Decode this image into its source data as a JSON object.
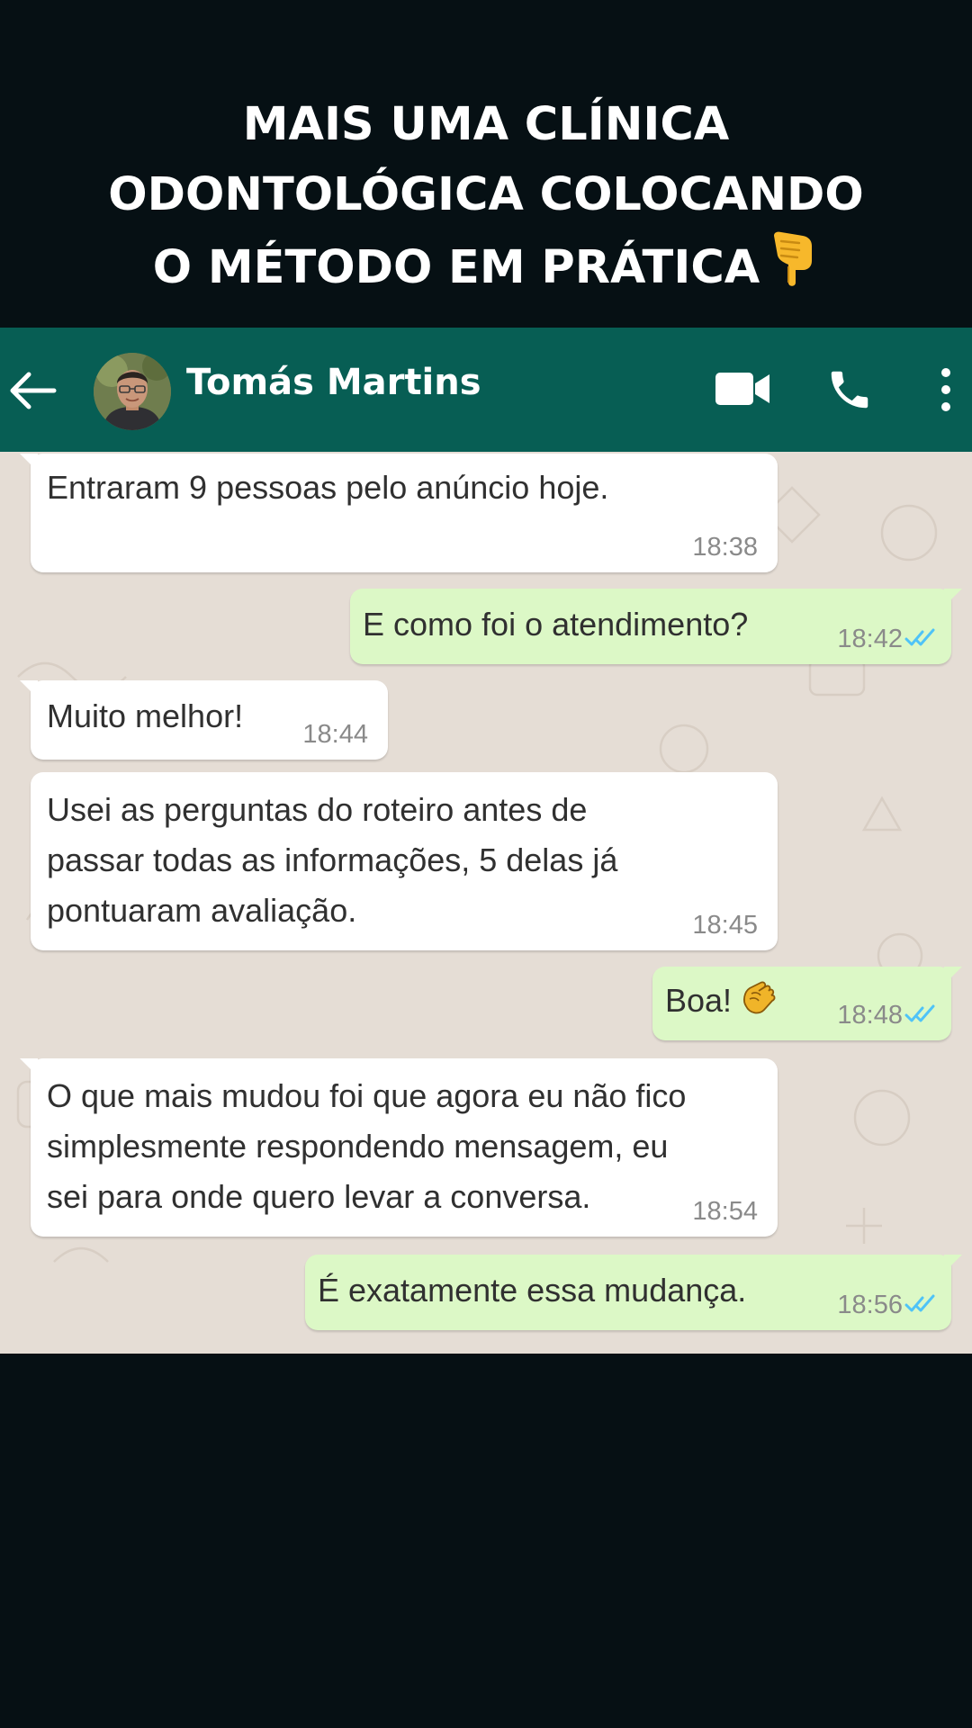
{
  "headline": {
    "line1": "MAIS UMA CLÍNICA",
    "line2": "ODONTOLÓGICA COLOCANDO",
    "line3": "O MÉTODO EM PRÁTICA",
    "emoji_icon": "pointing-down-hand-icon"
  },
  "header": {
    "contact_name": "Tomás Martins",
    "background_color": "#075e54",
    "icons": [
      "back-arrow-icon",
      "avatar",
      "video-camera-icon",
      "phone-icon",
      "more-vertical-icon"
    ]
  },
  "messages": [
    {
      "direction": "incoming",
      "lines": [
        "Entraram 9 pessoas pelo anúncio hoje."
      ],
      "time": "18:38"
    },
    {
      "direction": "outgoing",
      "lines": [
        "E como foi o atendimento?"
      ],
      "time": "18:42",
      "status": "read"
    },
    {
      "direction": "incoming",
      "lines": [
        "Muito melhor!"
      ],
      "time": "18:44"
    },
    {
      "direction": "incoming",
      "lines": [
        "Usei as perguntas do roteiro antes de",
        "passar todas as informações, 5 delas já",
        "pontuaram avaliação."
      ],
      "time": "18:45"
    },
    {
      "direction": "outgoing",
      "lines": [
        "Boa!"
      ],
      "time": "18:48",
      "status": "read",
      "emoji_icon": "clapping-hands-icon"
    },
    {
      "direction": "incoming",
      "lines": [
        "O que mais mudou foi que agora eu não fico",
        "simplesmente respondendo mensagem, eu",
        "sei para onde quero levar a conversa."
      ],
      "time": "18:54"
    },
    {
      "direction": "outgoing",
      "lines": [
        "É exatamente essa mudança."
      ],
      "time": "18:56",
      "status": "read"
    }
  ],
  "colors": {
    "page_background": "#061014",
    "chat_wallpaper": "#e5ddd5",
    "incoming_bubble": "#ffffff",
    "outgoing_bubble": "#dcf8c6",
    "read_ticks": "#4fc3f7"
  }
}
